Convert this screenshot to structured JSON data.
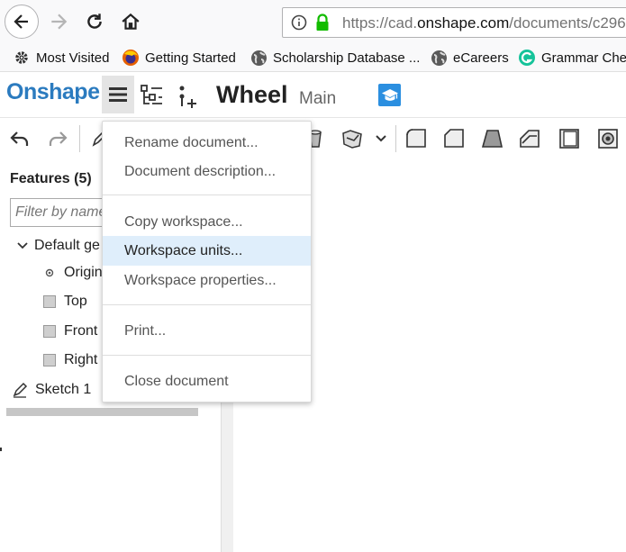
{
  "browser": {
    "url_prefix": "https://cad.",
    "url_domain": "onshape.com",
    "url_path": "/documents/c296",
    "bookmarks": [
      {
        "label": "Most Visited",
        "icon": "gear-icon"
      },
      {
        "label": "Getting Started",
        "icon": "firefox-icon"
      },
      {
        "label": "Scholarship Database ...",
        "icon": "globe-icon"
      },
      {
        "label": "eCareers",
        "icon": "globe-icon"
      },
      {
        "label": "Grammar Chec",
        "icon": "grammarly-icon"
      }
    ]
  },
  "app": {
    "logo": "Onshape",
    "doc_title": "Wheel",
    "branch": "Main",
    "brand_color": "#2b7bbf"
  },
  "features": {
    "title": "Features (5)",
    "filter_placeholder": "Filter by name",
    "tree": [
      {
        "label": "Default ge",
        "type": "group"
      },
      {
        "label": "Origin",
        "type": "origin"
      },
      {
        "label": "Top",
        "type": "plane"
      },
      {
        "label": "Front",
        "type": "plane"
      },
      {
        "label": "Right",
        "type": "plane"
      },
      {
        "label": "Sketch 1",
        "type": "sketch"
      }
    ]
  },
  "document_menu": {
    "items": [
      {
        "label": "Rename document..."
      },
      {
        "label": "Document description..."
      },
      {
        "label": "Copy workspace..."
      },
      {
        "label": "Workspace units...",
        "highlighted": true
      },
      {
        "label": "Workspace properties..."
      },
      {
        "label": "Print..."
      },
      {
        "label": "Close document"
      }
    ]
  }
}
